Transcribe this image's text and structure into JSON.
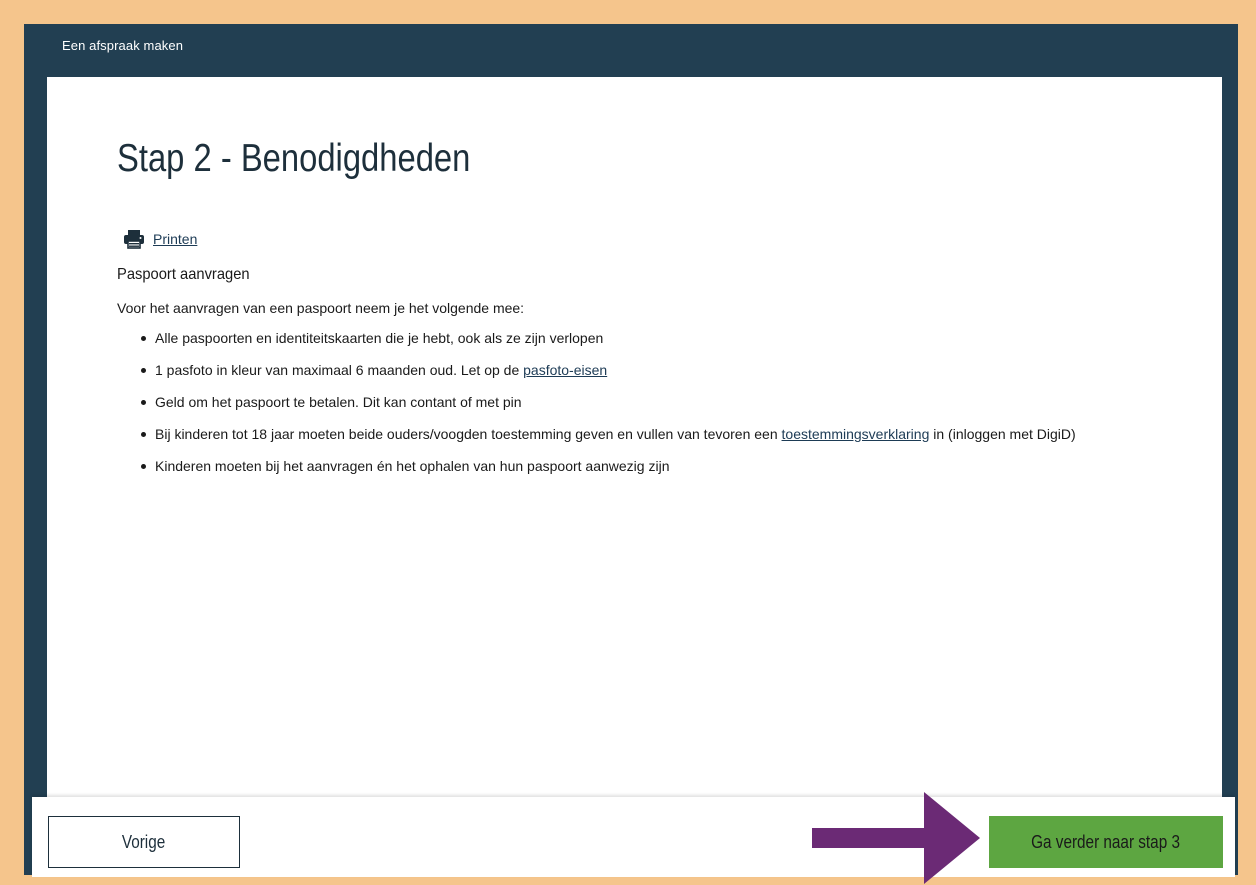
{
  "header": {
    "title": "Een afspraak maken"
  },
  "main": {
    "title": "Stap 2 - Benodigdheden",
    "print_label": "Printen",
    "section_title": "Paspoort aanvragen",
    "intro": "Voor het aanvragen van een paspoort neem je het volgende mee:",
    "items": [
      {
        "text": "Alle paspoorten en identiteitskaarten die je hebt, ook als ze zijn verlopen"
      },
      {
        "text": "1 pasfoto in kleur van maximaal 6 maanden oud. Let op de ",
        "link": "pasfoto-eisen"
      },
      {
        "text": "Geld om het paspoort te betalen. Dit kan contant of met pin"
      },
      {
        "text": "Bij kinderen tot 18 jaar moeten beide ouders/voogden toestemming geven en vullen van tevoren een ",
        "link": "toestemmingsverklaring",
        "after": " in (inloggen met DigiD)"
      },
      {
        "text": "Kinderen moeten bij het aanvragen én het ophalen van hun paspoort aanwezig zijn"
      }
    ]
  },
  "footer": {
    "prev_label": "Vorige",
    "next_label": "Ga verder naar stap 3"
  },
  "icons": {
    "print": "printer-icon",
    "annotation": "arrow-right-icon"
  },
  "colors": {
    "background": "#f5c58c",
    "frame": "#223f52",
    "next_button": "#5da641",
    "annotation_arrow": "#6b2a75"
  }
}
